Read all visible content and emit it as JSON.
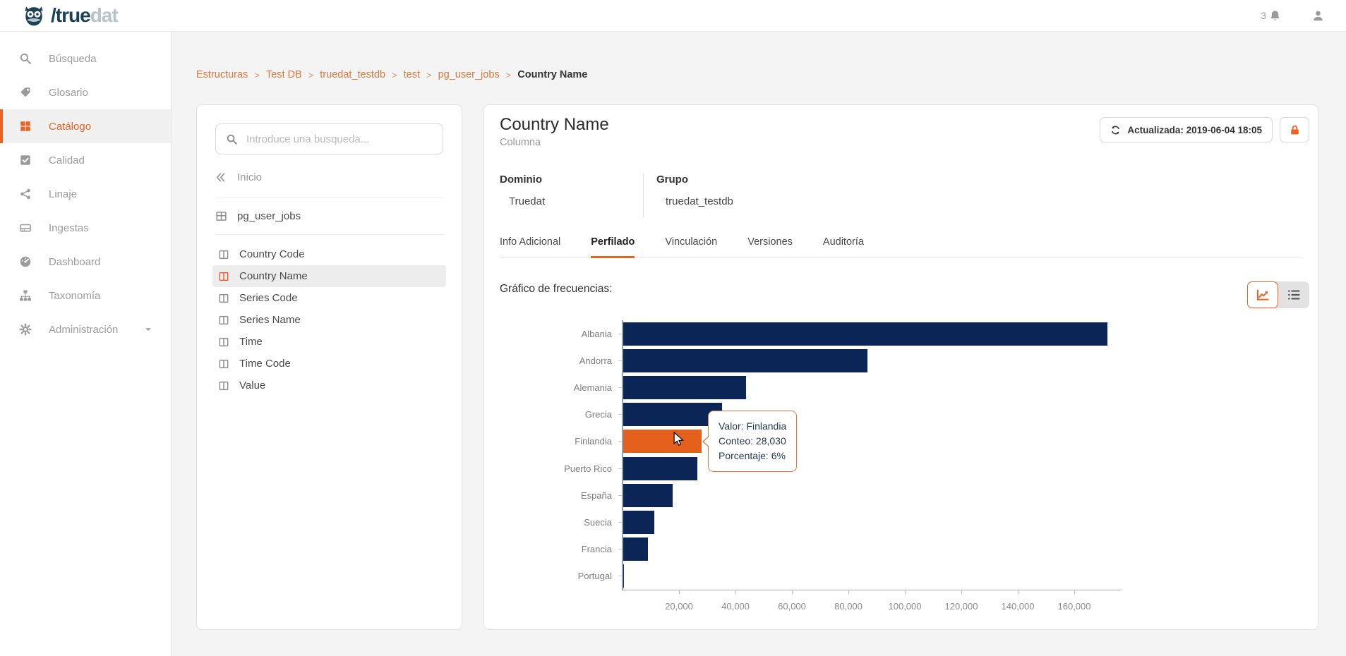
{
  "header": {
    "logo_true": "/true",
    "logo_dat": "dat",
    "notification_count": "3"
  },
  "sidebar": {
    "items": [
      {
        "label": "Búsqueda",
        "icon": "search",
        "active": false
      },
      {
        "label": "Glosario",
        "icon": "tags",
        "active": false
      },
      {
        "label": "Catálogo",
        "icon": "grid",
        "active": true
      },
      {
        "label": "Calidad",
        "icon": "check-square",
        "active": false
      },
      {
        "label": "Linaje",
        "icon": "share",
        "active": false
      },
      {
        "label": "Ingestas",
        "icon": "server",
        "active": false
      },
      {
        "label": "Dashboard",
        "icon": "gauge",
        "active": false
      },
      {
        "label": "Taxonomía",
        "icon": "sitemap",
        "active": false
      },
      {
        "label": "Administración",
        "icon": "gear",
        "active": false,
        "caret": true
      }
    ]
  },
  "breadcrumb": {
    "links": [
      "Estructuras",
      "Test DB",
      "truedat_testdb",
      "test",
      "pg_user_jobs"
    ],
    "current": "Country Name",
    "separator": ">"
  },
  "search_panel": {
    "placeholder": "Introduce una busqueda...",
    "back_label": "Inicio",
    "table_label": "pg_user_jobs",
    "columns": [
      "Country Code",
      "Country Name",
      "Series Code",
      "Series Name",
      "Time",
      "Time Code",
      "Value"
    ],
    "selected_index": 1
  },
  "detail": {
    "title": "Country Name",
    "subtitle": "Columna",
    "updated_label": "Actualizada: 2019-06-04 18:05",
    "fields": [
      {
        "label": "Dominio",
        "value": "Truedat"
      },
      {
        "label": "Grupo",
        "value": "truedat_testdb"
      }
    ],
    "tabs": [
      "Info Adicional",
      "Perfilado",
      "Vinculación",
      "Versiones",
      "Auditoría"
    ],
    "active_tab_index": 1,
    "chart_section_label": "Gráfico de frecuencias:"
  },
  "colors": {
    "accent": "#ec6225",
    "breadcrumb_link": "#d8793f",
    "bar": "#0b2556",
    "bar_highlight": "#e4601c"
  },
  "chart_data": {
    "type": "bar",
    "orientation": "horizontal",
    "title": "Gráfico de frecuencias",
    "categories": [
      "Albania",
      "Andorra",
      "Alemania",
      "Grecia",
      "Finlandia",
      "Puerto Rico",
      "España",
      "Suecia",
      "Francia",
      "Portugal"
    ],
    "values": [
      171700,
      86800,
      43800,
      35300,
      28030,
      26400,
      17700,
      11200,
      9100,
      400
    ],
    "highlighted_category": "Finlandia",
    "highlighted_index": 4,
    "xlim": [
      0,
      175750
    ],
    "xticks": [
      20000,
      40000,
      60000,
      80000,
      100000,
      120000,
      140000,
      160000
    ],
    "xtick_labels": [
      "20,000",
      "40,000",
      "60,000",
      "80,000",
      "100,000",
      "120,000",
      "140,000",
      "160,000"
    ],
    "grid": false,
    "legend": false,
    "tooltip": {
      "lines": [
        "Valor: Finlandia",
        "Conteo: 28,030",
        "Porcentaje: 6%"
      ],
      "valor": "Finlandia",
      "conteo": "28,030",
      "porcentaje": "6%"
    }
  }
}
